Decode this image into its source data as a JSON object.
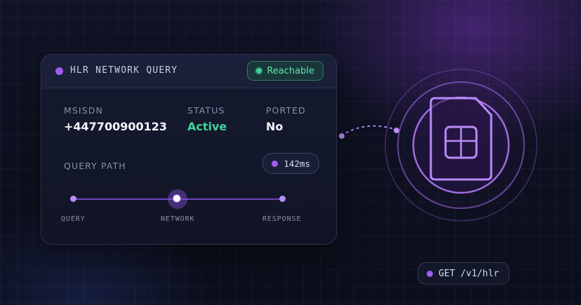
{
  "card": {
    "title": "HLR NETWORK QUERY",
    "badge": {
      "label": "Reachable",
      "icon": "status-dot-icon",
      "color": "#3fd497"
    },
    "fields": [
      {
        "label": "MSISDN",
        "value": "+447700900123"
      },
      {
        "label": "STATUS",
        "value": "Active"
      },
      {
        "label": "PORTED",
        "value": "No"
      }
    ],
    "path": {
      "label": "QUERY PATH",
      "latency": "142ms",
      "steps": [
        "QUERY",
        "NETWORK",
        "RESPONSE"
      ],
      "active_step": 1
    }
  },
  "sim": {
    "icon": "sim-card-icon"
  },
  "api": {
    "endpoint": "GET /v1/hlr"
  },
  "colors": {
    "accent": "#a25cf0",
    "success": "#3fd497",
    "background": "#0d0f1c"
  }
}
